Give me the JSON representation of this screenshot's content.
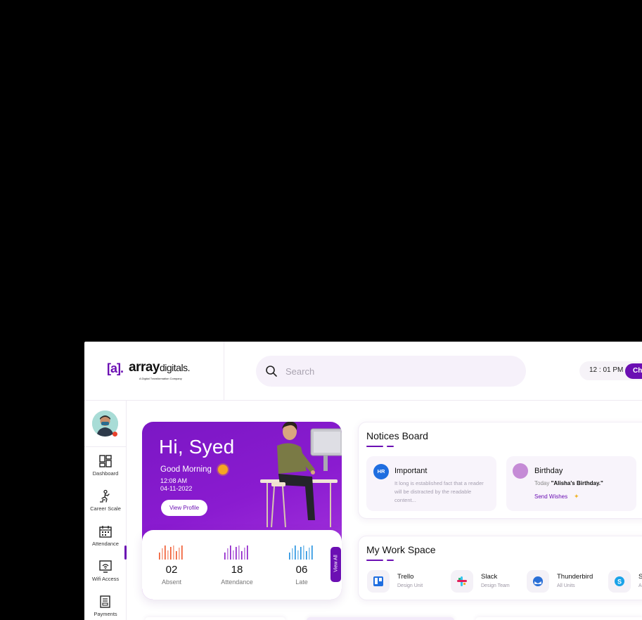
{
  "logo": {
    "mark": "[a].",
    "name_bold": "array",
    "name_light": "digitals.",
    "tagline": "A Digital Transformation Company"
  },
  "search": {
    "placeholder": "Search"
  },
  "header": {
    "clock": "12 : 01 PM",
    "check_label": "Ch"
  },
  "sidebar": {
    "items": [
      {
        "label": "Dashboard",
        "icon": "dashboard-icon"
      },
      {
        "label": "Career Scale",
        "icon": "career-scale-icon"
      },
      {
        "label": "Attendance",
        "icon": "calendar-icon"
      },
      {
        "label": "Wifi Access",
        "icon": "wifi-access-icon"
      },
      {
        "label": "Payments",
        "icon": "payments-icon"
      }
    ]
  },
  "welcome": {
    "greeting": "Hi, Syed",
    "subgreeting": "Good Morning",
    "time": "12:08 AM",
    "date": "04-11-2022",
    "view_profile": "View Profile",
    "view_all": "View All"
  },
  "stats": [
    {
      "value": "02",
      "label": "Absent",
      "color": "#f0552a"
    },
    {
      "value": "18",
      "label": "Attendance",
      "color": "#8a18c7"
    },
    {
      "value": "06",
      "label": "Late",
      "color": "#1f8fe0"
    }
  ],
  "notices": {
    "title": "Notices Board",
    "important": {
      "badge": "HR",
      "title": "Important",
      "body": "It long is established fact that a reader will be distracted by the readable content..."
    },
    "birthday": {
      "title": "Birthday",
      "text_prefix": "Today ",
      "text_bold": "\"Alisha's Birthday.\"",
      "action": "Send Wishes"
    }
  },
  "workspace": {
    "title": "My Work Space",
    "apps": [
      {
        "name": "Trello",
        "sub": "Design Unit",
        "icon": "trello-icon",
        "color": "#1f6ee0"
      },
      {
        "name": "Slack",
        "sub": "Design Team",
        "icon": "slack-icon",
        "color": "#e01e5a"
      },
      {
        "name": "Thunderbird",
        "sub": "All Units",
        "icon": "thunderbird-icon",
        "color": "#2a6fd6"
      },
      {
        "name": "S",
        "sub": "A",
        "icon": "skype-icon",
        "color": "#1aa3e8"
      }
    ]
  }
}
